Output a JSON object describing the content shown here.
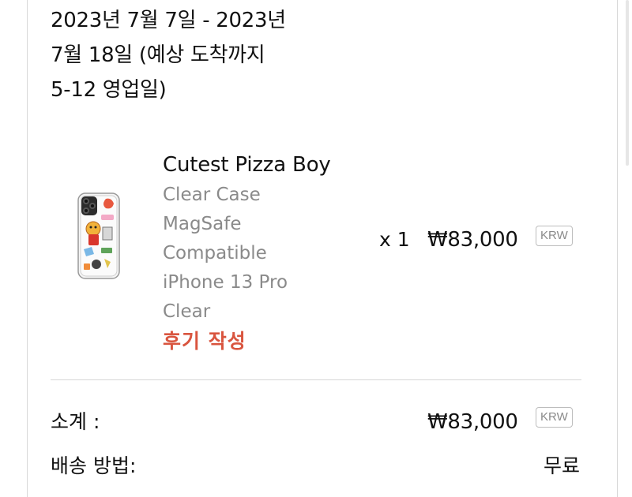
{
  "delivery": {
    "lines": [
      "2023년 7월 7일 - 2023년",
      "7월 18일 (예상 도착까지",
      "5-12 영업일)"
    ]
  },
  "item": {
    "title": "Cutest Pizza Boy",
    "variant_lines": [
      "Clear Case",
      "MagSafe",
      "Compatible",
      "iPhone 13 Pro",
      "Clear"
    ],
    "review_link": "후기 작성",
    "quantity": "x 1",
    "price": "₩83,000",
    "currency": "KRW"
  },
  "summary": {
    "subtotal_label": "소계 :",
    "subtotal_value": "₩83,000",
    "subtotal_currency": "KRW",
    "shipping_label": "배송 방법:",
    "shipping_value": "무료"
  },
  "colors": {
    "accent_review": "#d9553f",
    "muted_text": "#8a8a8a",
    "divider": "#d6d6d6"
  },
  "icons": {
    "product_thumbnail": "phone-case-thumbnail"
  }
}
